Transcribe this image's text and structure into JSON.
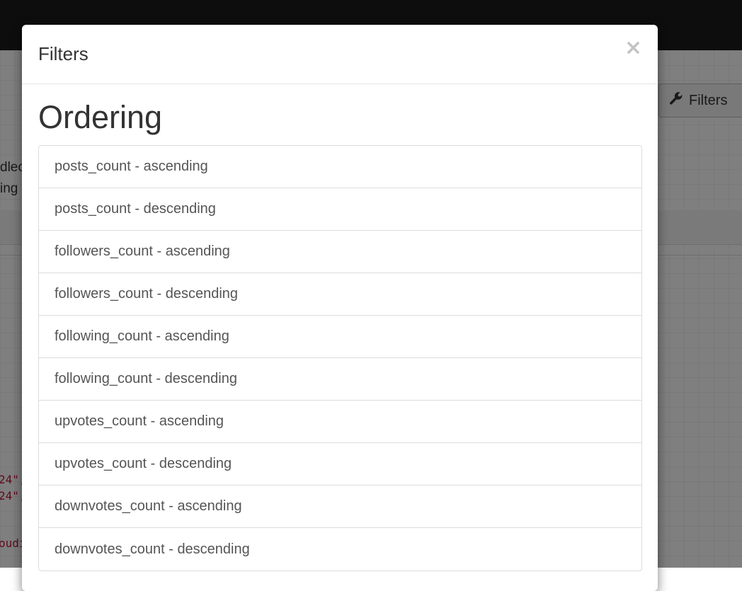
{
  "background": {
    "filters_button_label": "Filters",
    "text_line_1": "dlec",
    "text_line_2": "ing",
    "code_line_1": "24\",",
    "code_line_2": "24\",",
    "code_line_3": "oudi"
  },
  "modal": {
    "title": "Filters",
    "close_label": "×",
    "section_heading": "Ordering",
    "ordering_options": [
      {
        "label": "posts_count - ascending"
      },
      {
        "label": "posts_count - descending"
      },
      {
        "label": "followers_count - ascending"
      },
      {
        "label": "followers_count - descending"
      },
      {
        "label": "following_count - ascending"
      },
      {
        "label": "following_count - descending"
      },
      {
        "label": "upvotes_count - ascending"
      },
      {
        "label": "upvotes_count - descending"
      },
      {
        "label": "downvotes_count - ascending"
      },
      {
        "label": "downvotes_count - descending"
      }
    ]
  }
}
